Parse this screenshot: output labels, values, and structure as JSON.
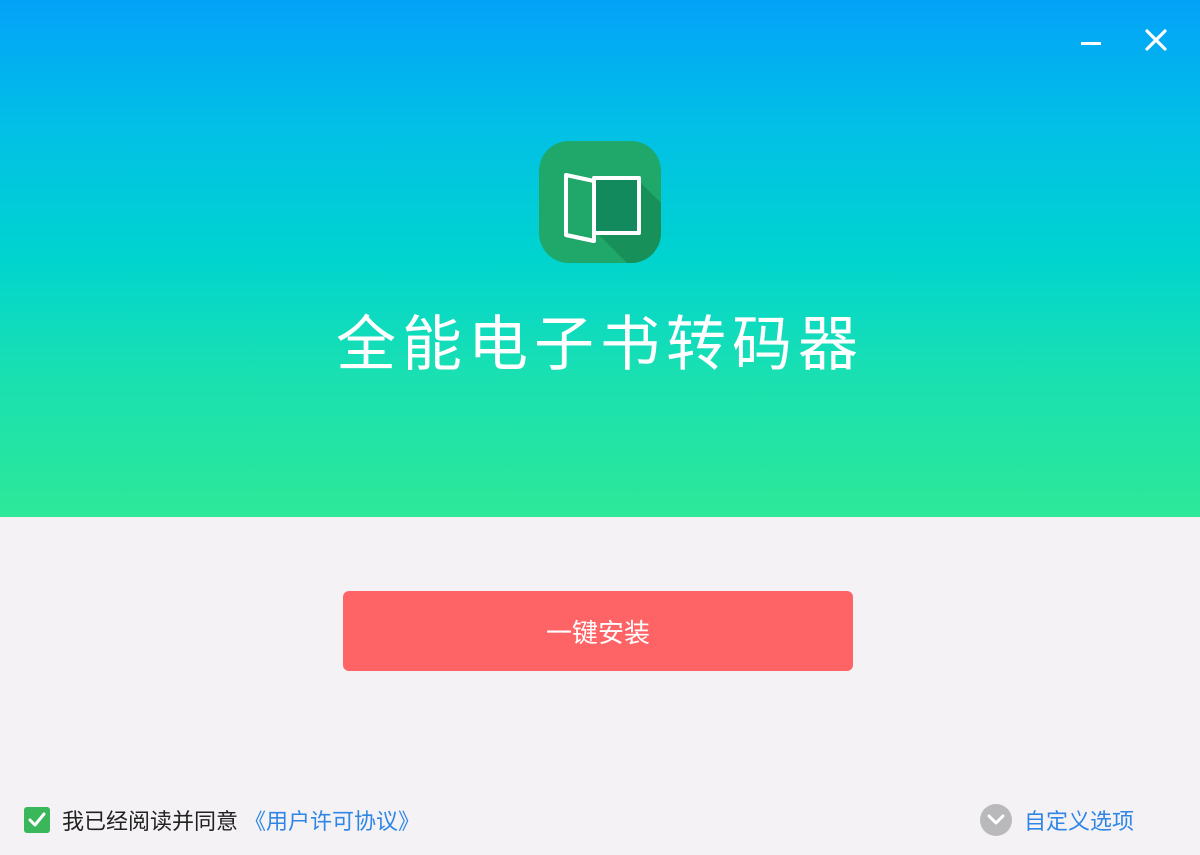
{
  "window": {
    "minimize_icon": "minimize-icon",
    "close_icon": "close-icon"
  },
  "app": {
    "logo_icon": "open-book-icon",
    "title": "全能电子书转码器"
  },
  "install": {
    "label": "一键安装"
  },
  "agreement": {
    "checked": true,
    "text": "我已经阅读并同意",
    "link_text": "《用户许可协议》"
  },
  "custom_options": {
    "icon": "chevron-down-icon",
    "label": "自定义选项"
  },
  "colors": {
    "gradient_top": "#03a2f9",
    "gradient_bottom": "#2de898",
    "install_button": "#fe6466",
    "checkbox": "#3ab75a",
    "link": "#2f86e6",
    "logo_bg": "#1fa86a"
  }
}
